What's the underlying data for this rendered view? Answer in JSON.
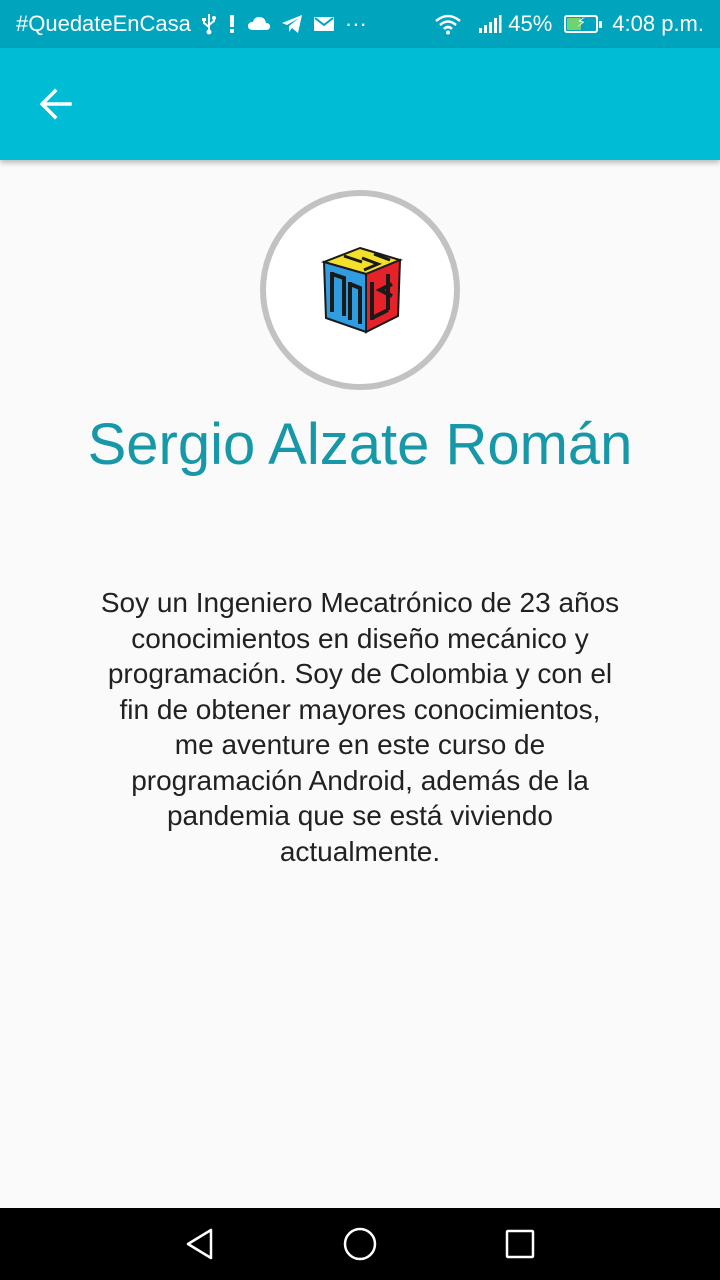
{
  "status_bar": {
    "hashtag": "#QuedateEnCasa",
    "more": "···",
    "battery_percent": "45%",
    "battery_level": 0.45,
    "time": "4:08 p.m.",
    "icons": [
      "usb-icon",
      "alert-icon",
      "cloud-icon",
      "telegram-icon",
      "mail-icon",
      "wifi-icon",
      "signal-icon",
      "battery-charging-icon"
    ]
  },
  "app_bar": {
    "back_icon": "arrow-back-icon",
    "color": "#00bcd4"
  },
  "profile": {
    "avatar_icon": "rubik-cube-logo",
    "name": "Sergio Alzate Román",
    "bio": "Soy un Ingeniero Mecatrónico de 23 años conocimientos en diseño mecánico y programación. Soy de Colombia y con el fin de obtener mayores conocimientos, me aventure en este curso de programación Android, además de la pandemia que se está viviendo actualmente.",
    "name_color": "#1798a8"
  },
  "nav_bar": {
    "buttons": [
      "back-triangle-icon",
      "home-circle-icon",
      "recents-square-icon"
    ]
  },
  "colors": {
    "status_bar": "#00a4bd",
    "app_bar": "#00bcd4",
    "background": "#fafafa"
  }
}
